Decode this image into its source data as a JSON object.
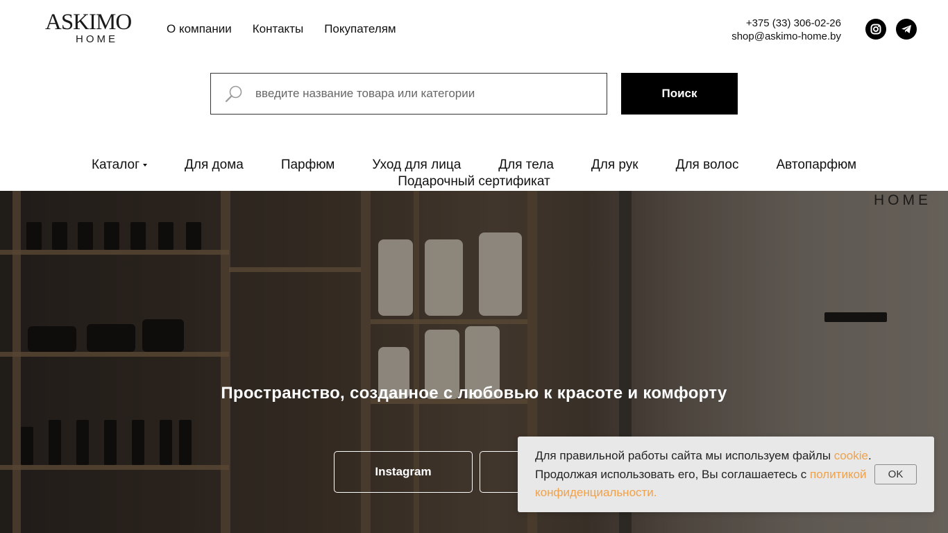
{
  "header": {
    "logo_main": "ASKIMO",
    "logo_sub": "HOME",
    "topnav": [
      "О компании",
      "Контакты",
      "Покупателям"
    ],
    "phone": "+375 (33) 306-02-26",
    "email": "shop@askimo-home.by"
  },
  "search": {
    "placeholder": "введите название товара или категории",
    "button_label": "Поиск"
  },
  "categories": {
    "row1": [
      "Каталог",
      "Для дома",
      "Парфюм",
      "Уход для лица",
      "Для тела",
      "Для рук",
      "Для волос",
      "Автопарфюм"
    ],
    "row2": "Подарочный сертификат"
  },
  "hero": {
    "brand": "HOME",
    "title": "Пространство, созданное с любовью к красоте и комфорту",
    "button_instagram": "Instagram"
  },
  "cookie": {
    "text_part1": "Для правильной работы сайта мы используем файлы ",
    "link_cookie": "cookie",
    "text_part2": ". Продолжая использовать его, Вы соглашаетесь с ",
    "link_policy": "политикой конфиденциальности.",
    "ok_label": "OK"
  },
  "colors": {
    "accent_link": "#f0a14a",
    "button_bg": "#000000",
    "banner_bg": "#e8e8e8"
  },
  "icons": [
    "search-icon",
    "instagram-icon",
    "telegram-icon",
    "dropdown-caret-icon"
  ]
}
